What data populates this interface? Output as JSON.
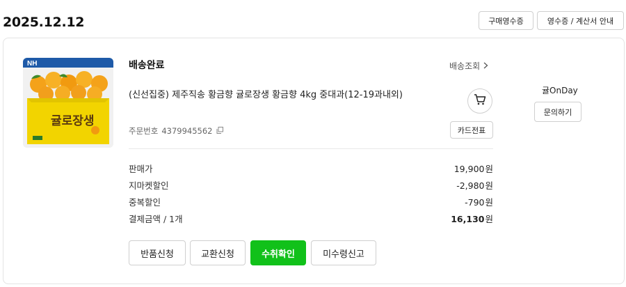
{
  "order_date": "2025.12.12",
  "header_buttons": {
    "purchase_receipt": "구매영수증",
    "receipt_tax_guide": "영수증 / 계산서 안내"
  },
  "product": {
    "brand_logo": "NH",
    "brand_sub": "",
    "box_label": "귤로장생",
    "status": "배송완료",
    "track_label": "배송조회",
    "name": "(신선집중) 제주직송 황금향 귤로장생 황금향 4kg 중대과(12-19과내외)",
    "order_number_label": "주문번호",
    "order_number": "4379945562",
    "card_receipt": "카드전표"
  },
  "seller": {
    "name": "귤OnDay",
    "inquiry_button": "문의하기"
  },
  "prices": [
    {
      "label": "판매가",
      "value": "19,900",
      "unit": "원",
      "bold": false
    },
    {
      "label": "지마켓할인",
      "value": "-2,980",
      "unit": "원",
      "bold": false
    },
    {
      "label": "중복할인",
      "value": "-790",
      "unit": "원",
      "bold": false
    },
    {
      "label": "결제금액 / 1개",
      "value": "16,130",
      "unit": "원",
      "bold": true
    }
  ],
  "actions": {
    "return": "반품신청",
    "exchange": "교환신청",
    "confirm": "수취확인",
    "not_received": "미수령신고"
  },
  "colors": {
    "primary": "#11c11a",
    "box_yellow": "#f2d400",
    "brand_blue": "#1e5aa8"
  },
  "icons": {
    "cart": "cart-icon",
    "chevron": "chevron-right-icon",
    "copy": "copy-icon"
  }
}
